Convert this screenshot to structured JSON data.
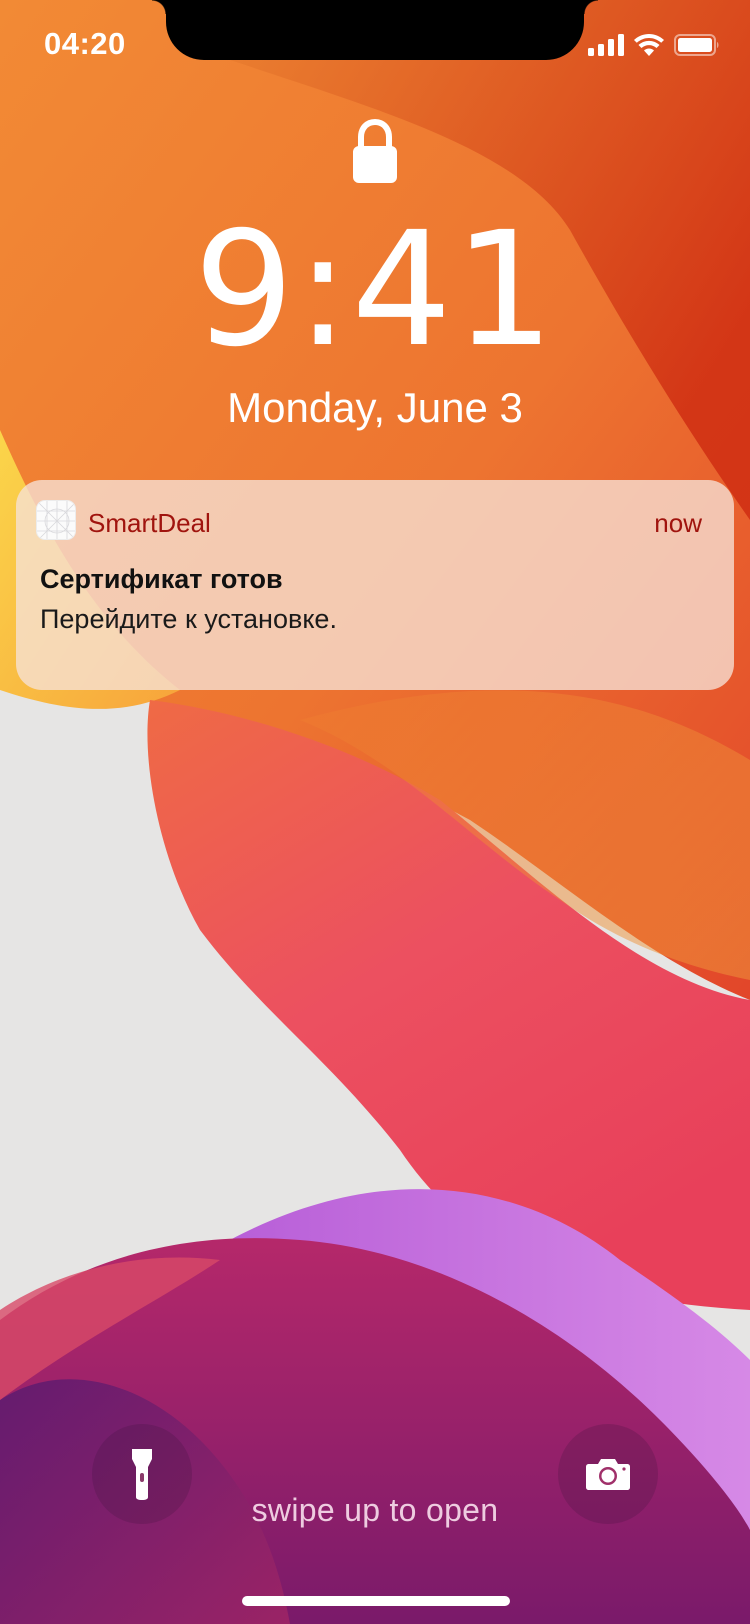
{
  "status_bar": {
    "time": "04:20",
    "signal_icon": "cellular-signal-icon",
    "wifi_icon": "wifi-icon",
    "battery_icon": "battery-icon"
  },
  "lock_screen": {
    "lock_icon": "lock-icon",
    "time": "9:41",
    "date": "Monday, June 3"
  },
  "notification": {
    "app_name": "SmartDeal",
    "app_icon": "smartdeal-app-icon",
    "time": "now",
    "title": "Сертификат готов",
    "body": "Перейдите к установке."
  },
  "quick_actions": {
    "flashlight_icon": "flashlight-icon",
    "camera_icon": "camera-icon"
  },
  "hint": "swipe up to open",
  "colors": {
    "wallpaper_orange": "#ee7a30",
    "wallpaper_red": "#e8455a",
    "wallpaper_magenta": "#b0286e",
    "wallpaper_purple": "#c47adf",
    "wallpaper_gray": "#e6e5e4",
    "notification_accent": "#a0140e"
  }
}
